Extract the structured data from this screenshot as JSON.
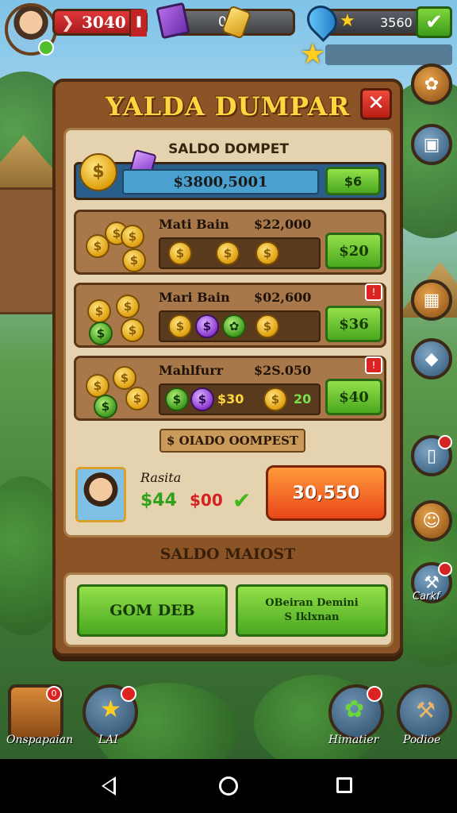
{
  "hud": {
    "lives_value": "3040",
    "gems_value": "0",
    "coins_value": "3560"
  },
  "modal": {
    "title": "YALDA DUMPAR",
    "close_symbol": "✕",
    "wallet": {
      "title": "SALDO DOMPET",
      "amount": "$3800,5001",
      "button_label": "$6"
    },
    "offers": [
      {
        "name": "Mati Bain",
        "price": "$22,000",
        "button_label": "$20"
      },
      {
        "name": "Mari Bain",
        "price": "$02,600",
        "button_label": "$36"
      },
      {
        "name": "Mahlfurr",
        "price": "$2S.050",
        "tray_left": "$30",
        "tray_right": "20",
        "button_label": "$40"
      }
    ],
    "banner": "$ OIADO OOMPEST",
    "player": {
      "name": "Rasita",
      "green_value": "$44",
      "red_value": "$00",
      "action_label": "30,550"
    },
    "subtitle": "SALDO MAIOST",
    "bottom": {
      "left_button": "GOM DEB",
      "right_line1": "OBeiran Demini",
      "right_line2": "S Iklxnan"
    }
  },
  "side": {
    "label_bottom": "Carkf"
  },
  "nav": {
    "items": [
      {
        "label": "Onspapaian",
        "badge": "0"
      },
      {
        "label": "LAI",
        "badge": ""
      },
      {
        "label": "Himatier",
        "badge": ""
      },
      {
        "label": "Podioe",
        "badge": ""
      }
    ]
  },
  "colors": {
    "accent_gold": "#ffd640",
    "button_green": "#4aa81f",
    "button_orange": "#e8461a",
    "close_red": "#b81d14"
  }
}
